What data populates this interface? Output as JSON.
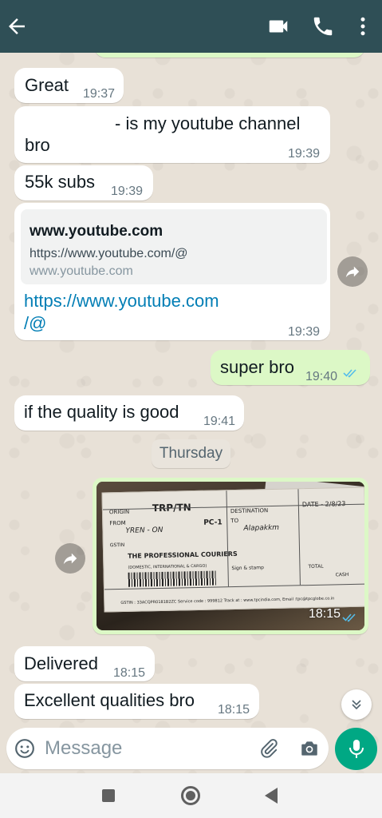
{
  "header": {
    "back_icon": "arrow-left-icon",
    "video_icon": "video-camera-icon",
    "call_icon": "phone-icon",
    "menu_icon": "more-vertical-icon",
    "bg_color": "#2f4f56"
  },
  "messages": [
    {
      "direction": "in",
      "text": "Great",
      "time": "19:37"
    },
    {
      "direction": "in",
      "text_line1": "- is my youtube channel",
      "text_line2": "bro",
      "time": "19:39"
    },
    {
      "direction": "in",
      "text": "55k subs",
      "time": "19:39"
    },
    {
      "direction": "in",
      "preview": {
        "title": "www.youtube.com",
        "url": "https://www.youtube.com/@",
        "domain": "www.youtube.com"
      },
      "link_line1": "https://www.youtube.com",
      "link_line2": "/@",
      "time": "19:39"
    },
    {
      "direction": "out",
      "text": "super bro",
      "time": "19:40",
      "status": "read"
    },
    {
      "direction": "in",
      "text": "if the quality is good",
      "time": "19:41"
    },
    {
      "direction": "out",
      "type": "image",
      "time": "18:15",
      "status": "read",
      "photo": {
        "origin": "ORIGIN",
        "brand": "TRP/TN",
        "destination": "DESTINATION",
        "date": "DATE - 2/8/23",
        "from": "FROM",
        "to": "TO",
        "pc": "PC-1",
        "handwriting_from": "YREN - ON",
        "handwriting_to": "Alapakkm",
        "gstin": "GSTIN",
        "company": "THE PROFESSIONAL COURIERS",
        "company_sub": "(DOMESTIC, INTERNATIONAL & CARGO)",
        "footer": "GSTIN : 33ACQPR0181B2ZC   Service code : 999812   Track at : www.tpcindia.com, Email :tpc@tpcglobe.co.in",
        "sign": "Sign & stamp",
        "total": "TOTAL",
        "cash": "CASH"
      }
    },
    {
      "direction": "in",
      "text": "Delivered",
      "time": "18:15"
    },
    {
      "direction": "in",
      "text": "Excellent qualities bro",
      "time": "18:15"
    }
  ],
  "date_divider": "Thursday",
  "composer": {
    "placeholder": "Message",
    "emoji_icon": "emoji-icon",
    "attach_icon": "paperclip-icon",
    "camera_icon": "camera-icon",
    "mic_icon": "microphone-icon",
    "accent": "#00a884"
  },
  "colors": {
    "incoming": "#ffffff",
    "outgoing": "#dcf8c6",
    "read_ticks": "#53bdeb",
    "link": "#027eb5"
  }
}
